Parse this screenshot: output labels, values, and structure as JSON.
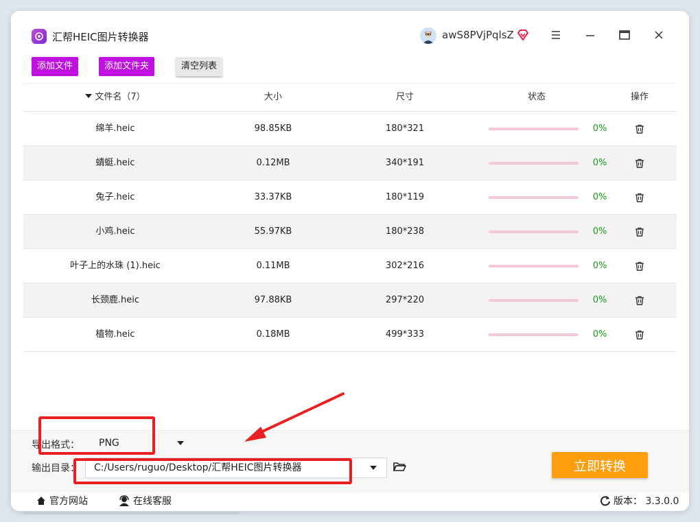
{
  "app": {
    "title": "汇帮HEIC图片转换器"
  },
  "user": {
    "name": "awS8PVjPqlsZ"
  },
  "toolbar": {
    "add_file": "添加文件",
    "add_folder": "添加文件夹",
    "clear_list": "清空列表"
  },
  "table": {
    "headers": {
      "name": "文件名（7）",
      "size": "大小",
      "dimensions": "尺寸",
      "status": "状态",
      "action": "操作"
    },
    "rows": [
      {
        "name": "绵羊.heic",
        "size": "98.85KB",
        "dimensions": "180*321",
        "percent": "0%",
        "progress": 0
      },
      {
        "name": "蜻蜓.heic",
        "size": "0.12MB",
        "dimensions": "340*191",
        "percent": "0%",
        "progress": 0
      },
      {
        "name": "兔子.heic",
        "size": "33.37KB",
        "dimensions": "180*119",
        "percent": "0%",
        "progress": 0
      },
      {
        "name": "小鸡.heic",
        "size": "55.97KB",
        "dimensions": "180*238",
        "percent": "0%",
        "progress": 0
      },
      {
        "name": "叶子上的水珠 (1).heic",
        "size": "0.11MB",
        "dimensions": "302*216",
        "percent": "0%",
        "progress": 0
      },
      {
        "name": "长颈鹿.heic",
        "size": "97.88KB",
        "dimensions": "297*220",
        "percent": "0%",
        "progress": 0
      },
      {
        "name": "植物.heic",
        "size": "0.18MB",
        "dimensions": "499*333",
        "percent": "0%",
        "progress": 0
      }
    ]
  },
  "export": {
    "format_label": "导出格式：",
    "format_value": "PNG",
    "dir_label": "输出目录：",
    "dir_value": "C:/Users/ruguo/Desktop/汇帮HEIC图片转换器"
  },
  "convert_button": "立即转换",
  "footer": {
    "website": "官方网站",
    "support": "在线客服",
    "version": "版本：  3.3.0.0"
  },
  "colors": {
    "accent_purple": "#c00fe0",
    "convert_orange": "#fe9e0e",
    "annotation_red": "#ea1f1f",
    "progress_track": "#f5c8d6",
    "percent_green": "#1a9b1a"
  }
}
